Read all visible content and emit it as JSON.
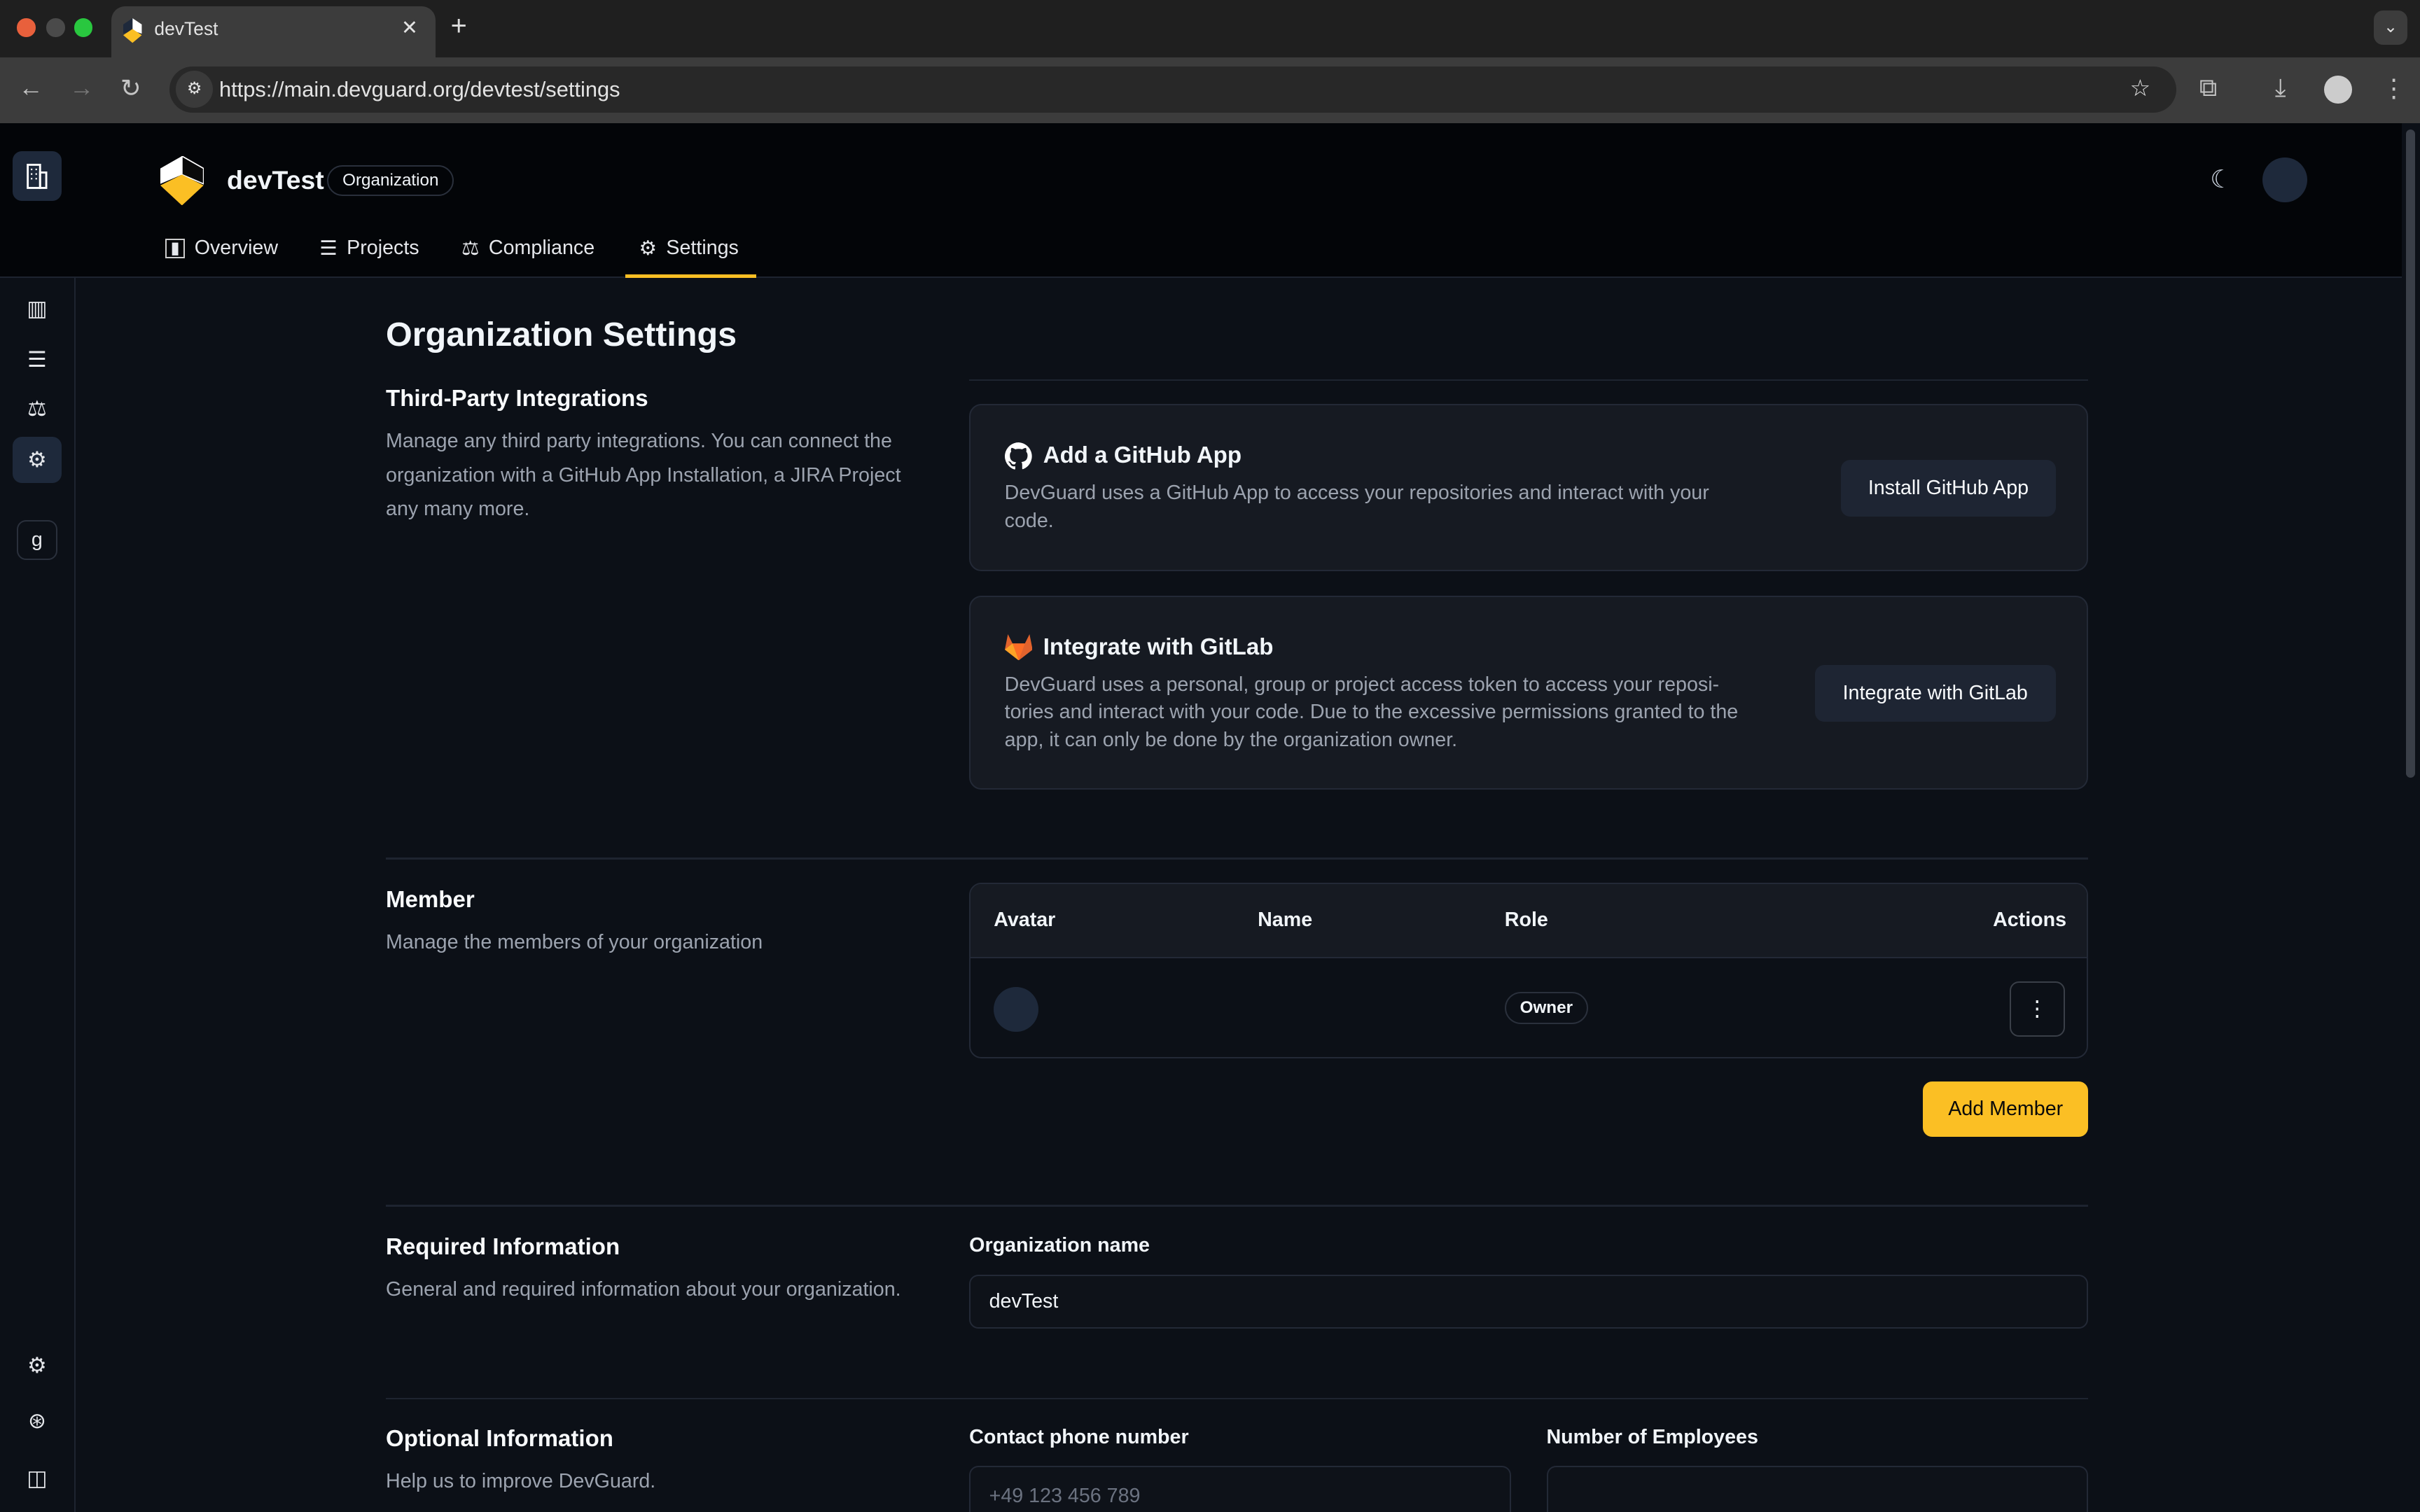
{
  "browser": {
    "tab_title": "devTest",
    "url": "https://main.devguard.org/devtest/settings"
  },
  "header": {
    "org_name": "devTest",
    "org_badge": "Organization",
    "nav": [
      {
        "label": "Overview"
      },
      {
        "label": "Projects"
      },
      {
        "label": "Compliance"
      },
      {
        "label": "Settings",
        "active": true
      }
    ]
  },
  "sidebar": {
    "org_initial": "g"
  },
  "colors": {
    "accent": "#fbbf24",
    "background": "#0c1017",
    "card": "#161a22"
  },
  "page": {
    "title": "Organization Settings",
    "integrations": {
      "title": "Third-Party Integrations",
      "description": "Manage any third party integrations. You can connect the organization with a GitHub App Installation, a JIRA Project any many more.",
      "github": {
        "title": "Add a GitHub App",
        "description": "DevGuard uses a GitHub App to access your repositories and interact with your code.",
        "button": "Install GitHub App"
      },
      "gitlab": {
        "title": "Integrate with GitLab",
        "description": "DevGuard uses a personal, group or project access token to access your reposi-tories and interact with your code. Due to the excessive permissions granted to the app, it can only be done by the organization owner.",
        "button": "Integrate with GitLab"
      }
    },
    "members": {
      "title": "Member",
      "description": "Manage the members of your organization",
      "columns": [
        "Avatar",
        "Name",
        "Role",
        "Actions"
      ],
      "rows": [
        {
          "name": "",
          "role": "Owner"
        }
      ],
      "add_button": "Add Member"
    },
    "required": {
      "title": "Required Information",
      "description": "General and required information about your organization.",
      "org_name_label": "Organization name",
      "org_name_value": "devTest"
    },
    "optional": {
      "title": "Optional Information",
      "description": "Help us to improve DevGuard.",
      "phone_label": "Contact phone number",
      "phone_placeholder": "+49 123 456 789",
      "employees_label": "Number of Employees",
      "employees_value": ""
    }
  }
}
